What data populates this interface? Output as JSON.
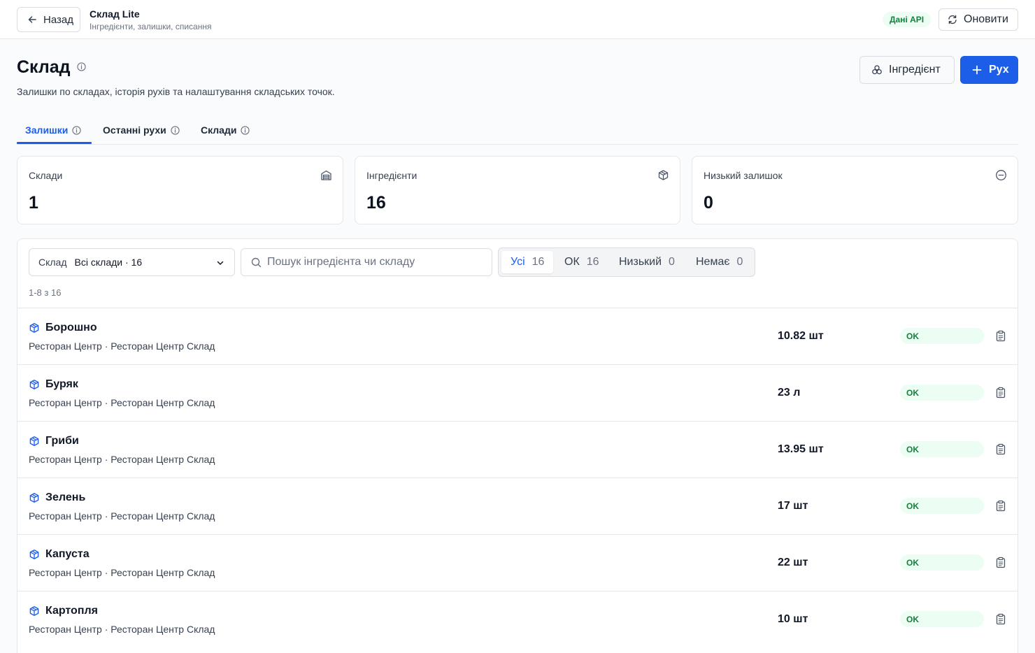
{
  "topbar": {
    "back_label": "Назад",
    "app_title": "Склад Lite",
    "app_subtitle": "Інгредієнти, залишки, списання",
    "api_badge": "Дані API",
    "refresh_label": "Оновити"
  },
  "header": {
    "title": "Склад",
    "description": "Залишки по складах, історія рухів та налаштування складських точок.",
    "ingredient_button": "Інгредієнт",
    "move_button": "Рух"
  },
  "tabs": [
    {
      "label": "Залишки",
      "active": true
    },
    {
      "label": "Останні рухи",
      "active": false
    },
    {
      "label": "Склади",
      "active": false
    }
  ],
  "stats": [
    {
      "label": "Склади",
      "value": "1",
      "icon": "warehouse-icon"
    },
    {
      "label": "Інгредієнти",
      "value": "16",
      "icon": "package-icon"
    },
    {
      "label": "Низький залишок",
      "value": "0",
      "icon": "minus-circle-icon"
    }
  ],
  "filters": {
    "warehouse_label": "Склад",
    "warehouse_value": "Всі склади · 16",
    "search_placeholder": "Пошук інгредієнта чи складу",
    "segments": [
      {
        "label": "Усі",
        "count": "16",
        "active": true
      },
      {
        "label": "ОК",
        "count": "16",
        "active": false
      },
      {
        "label": "Низький",
        "count": "0",
        "active": false
      },
      {
        "label": "Немає",
        "count": "0",
        "active": false
      }
    ],
    "range_text": "1-8 з 16"
  },
  "items": [
    {
      "name": "Борошно",
      "location": "Ресторан Центр · Ресторан Центр Склад",
      "qty": "10.82 шт",
      "status": "OK"
    },
    {
      "name": "Буряк",
      "location": "Ресторан Центр · Ресторан Центр Склад",
      "qty": "23 л",
      "status": "OK"
    },
    {
      "name": "Гриби",
      "location": "Ресторан Центр · Ресторан Центр Склад",
      "qty": "13.95 шт",
      "status": "OK"
    },
    {
      "name": "Зелень",
      "location": "Ресторан Центр · Ресторан Центр Склад",
      "qty": "17 шт",
      "status": "OK"
    },
    {
      "name": "Капуста",
      "location": "Ресторан Центр · Ресторан Центр Склад",
      "qty": "22 шт",
      "status": "OK"
    },
    {
      "name": "Картопля",
      "location": "Ресторан Центр · Ресторан Центр Склад",
      "qty": "10 шт",
      "status": "OK"
    }
  ],
  "colors": {
    "accent": "#1d5ee8",
    "ok_bg": "#ecfdf3",
    "ok_text": "#15803d"
  }
}
